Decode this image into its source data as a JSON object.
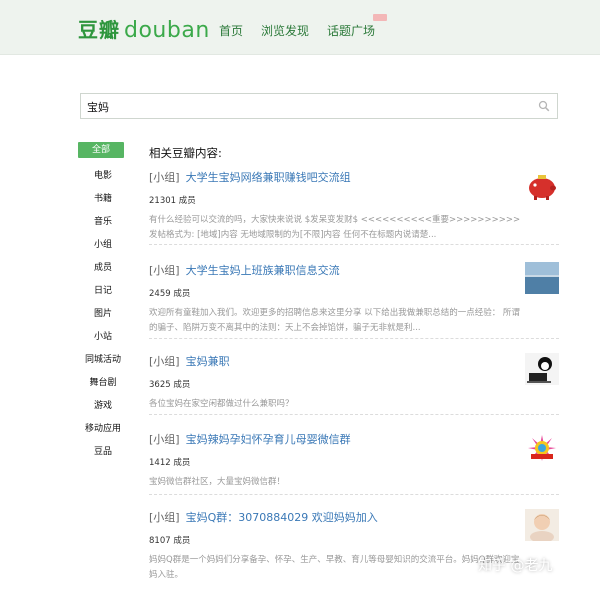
{
  "header": {
    "logo_cn": "豆瓣",
    "logo_en": "douban",
    "nav": [
      "首页",
      "浏览发现",
      "话题广场"
    ]
  },
  "search": {
    "value": "宝妈"
  },
  "sidebar": {
    "items": [
      "全部",
      "电影",
      "书籍",
      "音乐",
      "小组",
      "成员",
      "日记",
      "图片",
      "小站",
      "同城活动",
      "舞台剧",
      "游戏",
      "移动应用",
      "豆品"
    ],
    "active_index": 0
  },
  "main": {
    "title": "相关豆瓣内容:",
    "results": [
      {
        "tag": "[小组]",
        "title": "大学生宝妈网络兼职赚钱吧交流组",
        "meta": "21301 成员",
        "desc": "有什么经验可以交流的吗，大家快来说说 $发呆变发财$ <<<<<<<<<<重要>>>>>>>>>> 发帖格式为: [地域]内容 无地域限制的为[不限]内容 任何不在标题内说请楚...",
        "thumb": "piggy-bank-thumbnail"
      },
      {
        "tag": "[小组]",
        "title": "大学生宝妈上班族兼职信息交流",
        "meta": "2459 成员",
        "desc": "欢迎所有童鞋加入我们。欢迎更多的招聘信息来这里分享 以下给出我做兼职总结的一点经验： 所谓的骗子、陷阱万变不离其中的法则：天上不会掉馅饼，骗子无非就是利...",
        "thumb": "sea-landscape-thumbnail"
      },
      {
        "tag": "[小组]",
        "title": "宝妈兼职",
        "meta": "3625 成员",
        "desc": "各位宝妈在家空闲都做过什么兼职吗？",
        "thumb": "cartoon-laptop-thumbnail"
      },
      {
        "tag": "[小组]",
        "title": "宝妈辣妈孕妇怀孕育儿母婴微信群",
        "meta": "1412 成员",
        "desc": "宝妈微信群社区，大量宝妈微信群！",
        "thumb": "colorful-badge-thumbnail"
      },
      {
        "tag": "[小组]",
        "title": "宝妈Q群：3070884029 欢迎妈妈加入",
        "meta": "8107 成员",
        "desc": "妈妈Q群是一个妈妈们分享备孕、怀孕、生产、早教、育儿等母婴知识的交流平台。妈妈Q群欢迎宝妈入驻。",
        "thumb": "baby-photo-thumbnail"
      }
    ]
  },
  "watermark": "知乎 @老九",
  "colors": {
    "brand_green": "#2e963d",
    "active_green": "#57b563",
    "link_blue": "#3a78b6",
    "header_bg": "#eef3ee"
  }
}
